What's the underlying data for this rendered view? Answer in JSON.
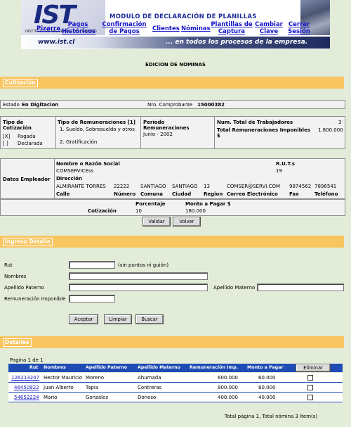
{
  "banner": {
    "logo": "IST",
    "logo_sub": "INSTITUTO DE SEGURIDAD DEL TRABAJO",
    "title": "MODULO DE DECLARACIÓN DE PLANILLAS",
    "nav": [
      "Pizarra",
      "Pagos Históricos",
      "Confirmación de Pagos",
      "Clientes",
      "Nóminas",
      "Plantillas de Captura",
      "Cambiar Clave",
      "Cerrar Sesión"
    ],
    "url": "www.ist.cl",
    "tagline": "... en todos los procesos de la empresa."
  },
  "page_title": "EDICION DE NOMINAS",
  "cotizacion": {
    "section_label": "Cotización",
    "estado_label": "Estado",
    "estado_value": "En Digitacion",
    "comprobante_label": "Nro. Comprobante",
    "comprobante_value": "15000382",
    "tipo_cotizacion_label": "Tipo de Cotización",
    "tipo_pagada_mark": "[X]",
    "tipo_pagada": "Pagada",
    "tipo_declarada_mark": "[ ]",
    "tipo_declarada": "Declarada",
    "tipo_rem_label": "Tipo de Remuneraciones [1]",
    "tipo_rem_items": [
      "Sueldo, Sobresueldo y otros",
      "Gratificación"
    ],
    "periodo_label": "Período Remuneraciones",
    "periodo_value": "Junio - 2002",
    "num_trab_label": "Num. Total de Trabajadores",
    "num_trab_value": "3",
    "total_rem_label": "Total Remuneraciones Imponibles $",
    "total_rem_value": "1.800.000"
  },
  "empleador": {
    "label": "Datos Empleador",
    "razon_label": "Nombre o Razón Social",
    "razon_value": "COMSERVICEss",
    "ruts_label": "R.U.T.s",
    "ruts_value": "19",
    "direccion_label": "Dirección",
    "values": [
      "ALMIRANTE TORRES",
      "22222",
      "SANTIAGO",
      "SANTIAGO",
      "13",
      "COMSER@SERVI.COM",
      "9874562",
      "7896541"
    ],
    "headers": [
      "Calle",
      "Número",
      "Comuna",
      "Ciudad",
      "Region",
      "Correo Electrónico",
      "Fax",
      "Teléfono"
    ]
  },
  "cotizacion_pct": {
    "label": "Cotización",
    "porcentaje_label": "Porcentaje",
    "porcentaje_value": "10",
    "monto_label": "Monto a Pagar $",
    "monto_value": "180.000"
  },
  "buttons": {
    "validar": "Validar",
    "volver": "Volver",
    "aceptar": "Aceptar",
    "limpiar": "Limpiar",
    "buscar": "Buscar",
    "eliminar": "Eliminar"
  },
  "ingreso": {
    "section_label": "Ingreso Detalle",
    "rut_label": "Rut",
    "rut_hint": "(sin puntos ni guión)",
    "nombres_label": "Nombres",
    "ap_paterno_label": "Apellido Paterno",
    "ap_materno_label": "Apellido Materno",
    "rem_label": "Remuneración Imponible"
  },
  "detalles": {
    "section_label": "Detalles",
    "pagina": "Pagina 1 de 1",
    "columns": [
      "Rut",
      "Nombres",
      "Apellido Paterno",
      "Apellido Materno",
      "Remuneración Imp.",
      "Monto a Pagar"
    ],
    "rows": [
      {
        "rut": "126213247",
        "nombres": "Hector Mauricio",
        "paterno": "Moreno",
        "materno": "Ahumada",
        "rem": "600.000",
        "monto": "60.000"
      },
      {
        "rut": "46450922",
        "nombres": "Juan Alberto",
        "paterno": "Tapia",
        "materno": "Contreras",
        "rem": "800.000",
        "monto": "80.000"
      },
      {
        "rut": "54652224",
        "nombres": "Mario",
        "paterno": "González",
        "materno": "Donoso",
        "rem": "400.000",
        "monto": "40.000"
      }
    ],
    "footer": "Total página 1, Total nómina 3 item(s)"
  }
}
